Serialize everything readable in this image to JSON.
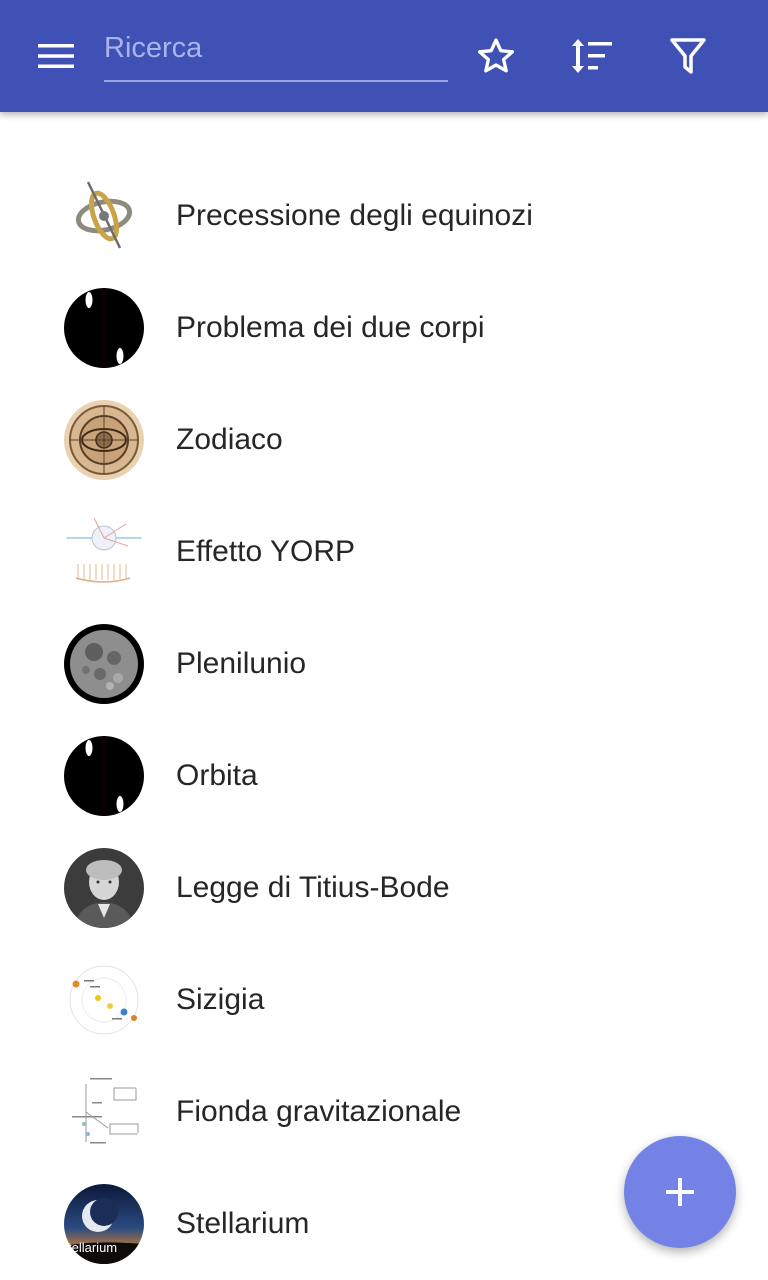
{
  "toolbar": {
    "search_placeholder": "Ricerca",
    "search_value": "",
    "icons": [
      "menu-icon",
      "star-outline-icon",
      "sort-icon",
      "filter-icon"
    ],
    "color": "#3f51b5"
  },
  "items": [
    {
      "label": "Precessione degli equinozi",
      "thumb": "gyroscope-image"
    },
    {
      "label": "Problema dei due corpi",
      "thumb": "orbit-animation-image"
    },
    {
      "label": "Zodiaco",
      "thumb": "zodiac-engraving-image"
    },
    {
      "label": "Effetto YORP",
      "thumb": "yorp-diagram-image"
    },
    {
      "label": "Plenilunio",
      "thumb": "full-moon-image"
    },
    {
      "label": "Orbita",
      "thumb": "orbit-animation-image"
    },
    {
      "label": "Legge di Titius-Bode",
      "thumb": "portrait-engraving-image"
    },
    {
      "label": "Sizigia",
      "thumb": "syzygy-diagram-image"
    },
    {
      "label": "Fionda gravitazionale",
      "thumb": "gravity-assist-diagram-image"
    },
    {
      "label": "Stellarium",
      "thumb": "stellarium-logo-image",
      "thumb_text": "tellarium"
    }
  ],
  "fab": {
    "icon": "plus-icon",
    "color": "#7482e6"
  }
}
